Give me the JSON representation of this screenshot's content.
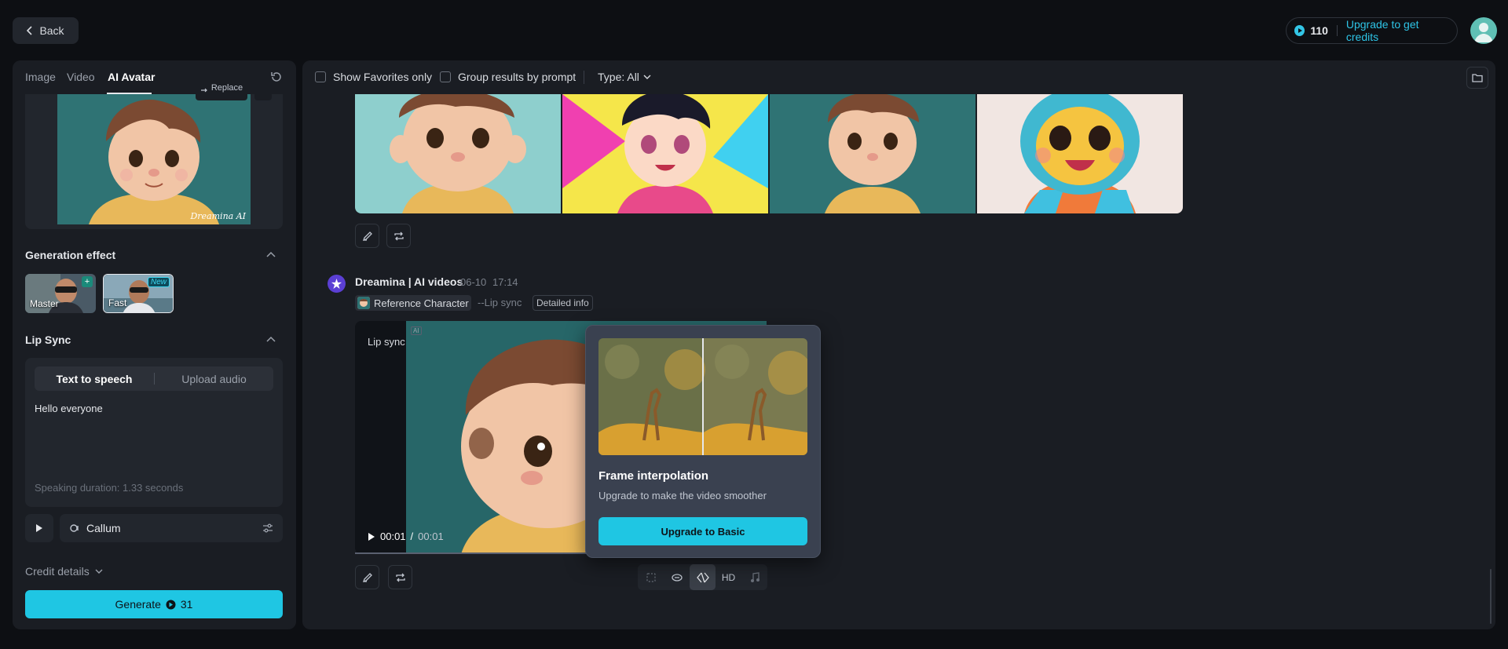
{
  "top_bar": {
    "back_label": "Back",
    "credits": "110",
    "upgrade_label": "Upgrade to get credits"
  },
  "left_panel": {
    "tabs": [
      {
        "label": "Image"
      },
      {
        "label": "Video"
      },
      {
        "label": "AI Avatar"
      }
    ],
    "active_tab": "AI Avatar",
    "reference_card": {
      "replace_label": "Replace",
      "watermark": "Dreamina AI"
    },
    "generation_effect": {
      "title": "Generation effect",
      "options": [
        {
          "label": "Master",
          "badge": "+"
        },
        {
          "label": "Fast",
          "badge": "New",
          "selected": true
        }
      ]
    },
    "lip_sync": {
      "title": "Lip Sync",
      "segments": [
        {
          "label": "Text to speech"
        },
        {
          "label": "Upload audio"
        }
      ],
      "active_segment": "Text to speech",
      "text": "Hello everyone",
      "speaking_duration": "Speaking duration: 1.33 seconds",
      "voice": "Callum"
    },
    "credit_details_label": "Credit details",
    "generate": {
      "label": "Generate",
      "cost": "31"
    }
  },
  "right_panel": {
    "filters": {
      "show_favorites_label": "Show Favorites only",
      "group_by_prompt_label": "Group results by prompt",
      "type_label": "Type: All"
    },
    "result": {
      "author": "Dreamina | AI videos",
      "date": "06-10",
      "time": "17:14",
      "reference_tag": "Reference Character",
      "mode_tag": "--Lip sync",
      "detail_button": "Detailed info",
      "video_label": "Lip sync",
      "ai_mark": "AI",
      "current_time": "00:01",
      "duration": "00:01",
      "time_separator": "/",
      "hd_label": "HD"
    }
  },
  "popup": {
    "title": "Frame interpolation",
    "description": "Upgrade to make the video smoother",
    "button": "Upgrade to Basic"
  },
  "colors": {
    "accent": "#1fc6e3",
    "panel_bg": "#1a1d23",
    "page_bg": "#0d0f13",
    "popup_bg": "#3a4150"
  }
}
